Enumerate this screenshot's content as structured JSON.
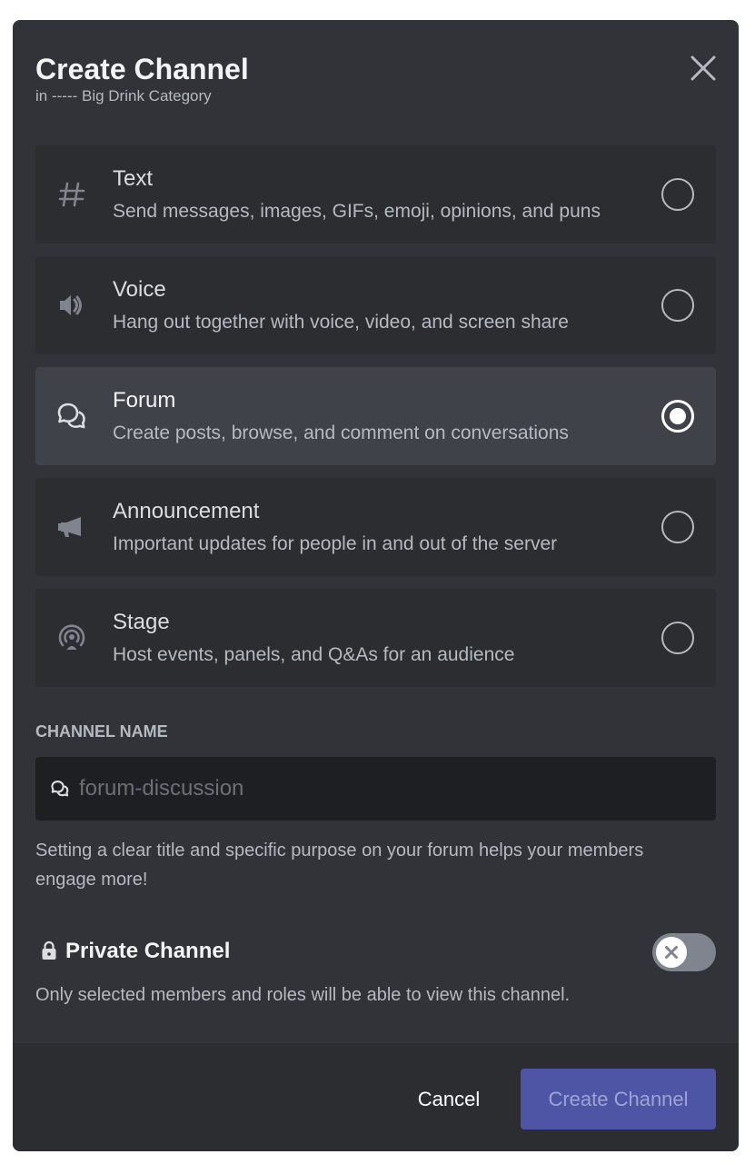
{
  "dialog": {
    "title": "Create Channel",
    "subtitle": "in ----- Big Drink Category"
  },
  "options": [
    {
      "name": "Text",
      "description": "Send messages, images, GIFs, emoji, opinions, and puns",
      "icon": "hash-icon",
      "selected": false
    },
    {
      "name": "Voice",
      "description": "Hang out together with voice, video, and screen share",
      "icon": "speaker-icon",
      "selected": false
    },
    {
      "name": "Forum",
      "description": "Create posts, browse, and comment on conversations",
      "icon": "forum-icon",
      "selected": true
    },
    {
      "name": "Announcement",
      "description": "Important updates for people in and out of the server",
      "icon": "megaphone-icon",
      "selected": false
    },
    {
      "name": "Stage",
      "description": "Host events, panels, and Q&As for an audience",
      "icon": "stage-icon",
      "selected": false
    }
  ],
  "channel_name": {
    "label": "CHANNEL NAME",
    "placeholder": "forum-discussion",
    "value": "",
    "helper": "Setting a clear title and specific purpose on your forum helps your members engage more!"
  },
  "private": {
    "label": "Private Channel",
    "description": "Only selected members and roles will be able to view this channel.",
    "enabled": false
  },
  "footer": {
    "cancel_label": "Cancel",
    "create_label": "Create Channel"
  },
  "colors": {
    "modal_bg": "#313338",
    "option_bg": "#2b2d31",
    "option_selected_bg": "#404249",
    "input_bg": "#1e1f22",
    "brand_disabled": "#4e55a4",
    "toggle_off": "#80848e"
  }
}
